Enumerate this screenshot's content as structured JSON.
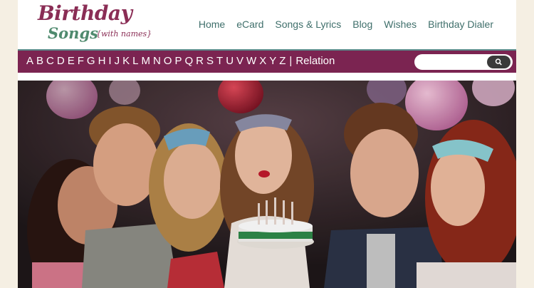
{
  "logo": {
    "line1": "Birthday",
    "line2": "Songs",
    "tagline": "{with names}"
  },
  "nav": [
    "Home",
    "eCard",
    "Songs & Lyrics",
    "Blog",
    "Wishes",
    "Birthday Dialer"
  ],
  "alphabet": [
    "A",
    "B",
    "C",
    "D",
    "E",
    "F",
    "G",
    "H",
    "I",
    "J",
    "K",
    "L",
    "M",
    "N",
    "O",
    "P",
    "Q",
    "R",
    "S",
    "T",
    "U",
    "V",
    "W",
    "X",
    "Y",
    "Z"
  ],
  "separator": "|",
  "relation_label": "Relation",
  "search": {
    "placeholder": "",
    "button_icon": "search-icon"
  },
  "colors": {
    "brand": "#7b2451",
    "nav_text": "#3f6f6b",
    "logo_green": "#4f8a6e",
    "page_bg": "#f5efe3"
  },
  "hero": {
    "image": "friends celebrating around a birthday cake with candles"
  }
}
